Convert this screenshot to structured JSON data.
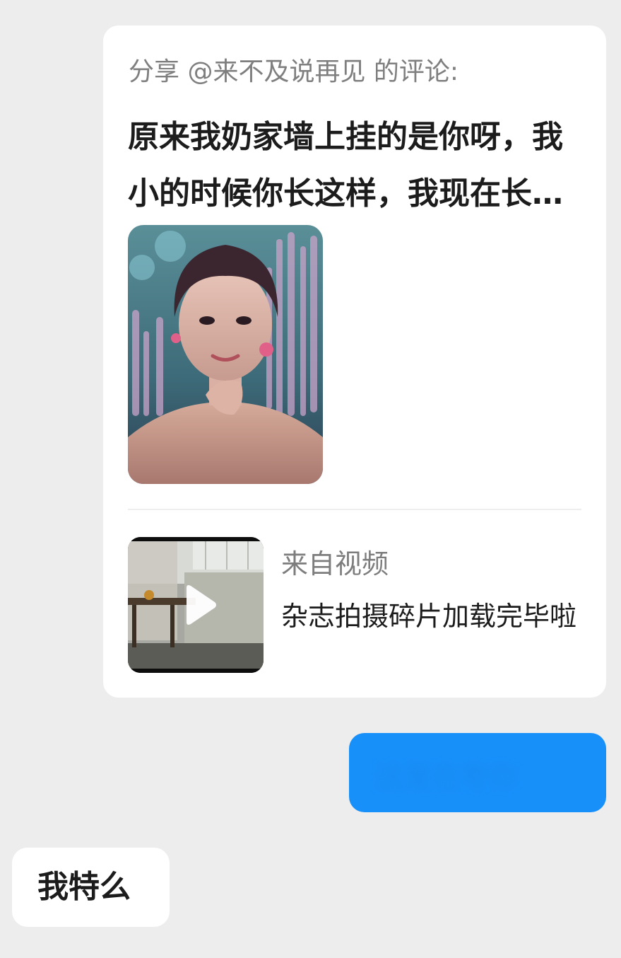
{
  "share_card": {
    "header": "分享 @来不及说再见 的评论:",
    "comment_text": "原来我奶家墙上挂的是你呀，我小的时候你长这样，我现在长大了你还是这样，岁月从不败美人",
    "image_label": "portrait-photo",
    "video": {
      "source_label": "来自视频",
      "title": "杂志拍摄碎片加载完毕啦"
    }
  },
  "messages": {
    "sent": {
      "text": "这是在夸你",
      "obscured": true
    },
    "received": {
      "text": "我特么"
    }
  },
  "colors": {
    "background": "#ededed",
    "card": "#ffffff",
    "sent_bubble": "#1890fa",
    "header_gray": "#7f7f7f",
    "text_dark": "#1c1c1c"
  },
  "icons": {
    "play": "play-icon"
  }
}
